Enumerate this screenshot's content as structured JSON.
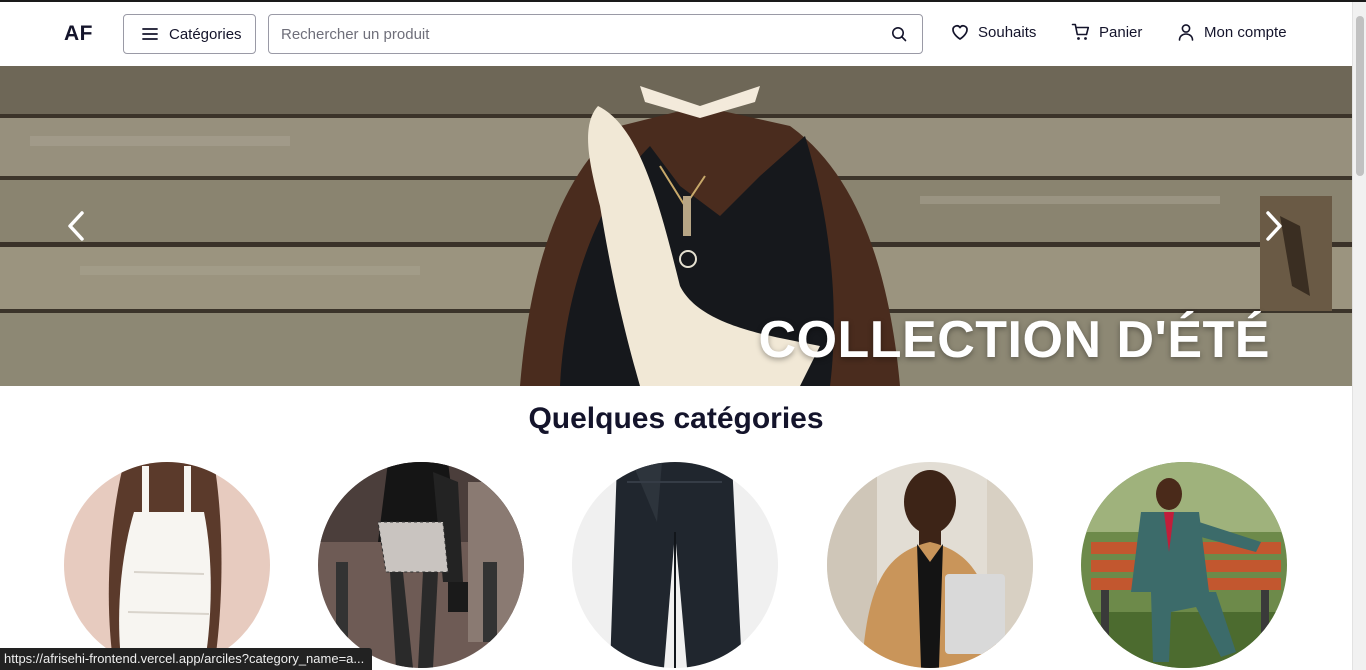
{
  "header": {
    "logo": "AF",
    "categories_label": "Catégories",
    "search_placeholder": "Rechercher un produit",
    "wishlist_label": "Souhaits",
    "cart_label": "Panier",
    "account_label": "Mon compte"
  },
  "hero": {
    "title": "COLLECTION D'ÉTÉ"
  },
  "section": {
    "title": "Quelques catégories"
  },
  "categories": [
    {
      "icon": "white-dress-image"
    },
    {
      "icon": "tweed-skirt-image"
    },
    {
      "icon": "dark-jeans-image"
    },
    {
      "icon": "camel-coat-man-image"
    },
    {
      "icon": "suit-man-bench-image"
    }
  ],
  "status_bar": {
    "url": "https://afrisehi-frontend.vercel.app/arciles?category_name=a..."
  }
}
